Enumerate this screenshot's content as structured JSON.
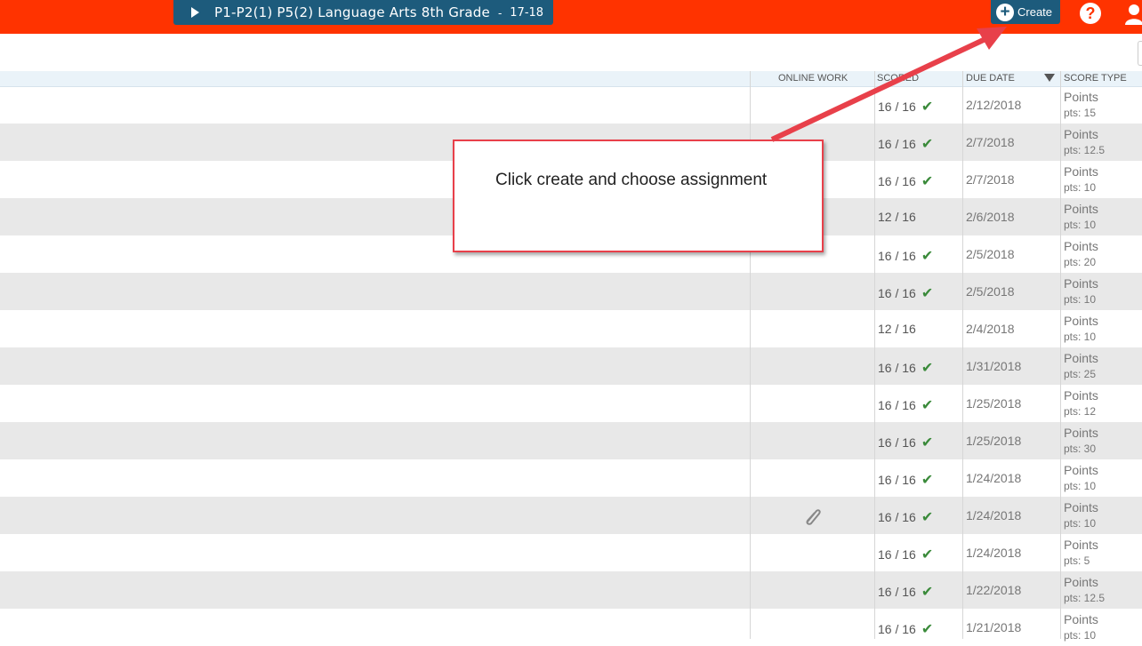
{
  "header": {
    "class_name": "P1-P2(1) P5(2) Language Arts 8th Grade",
    "separator": "-",
    "year": "17-18",
    "create_label": "Create",
    "help_symbol": "?"
  },
  "table": {
    "columns": {
      "online_work": "ONLINE WORK",
      "scored": "SCORED",
      "due_date": "DUE DATE",
      "score_type": "SCORE TYPE"
    },
    "rows": [
      {
        "scored": "16 / 16",
        "complete": true,
        "due": "2/12/2018",
        "type": "Points",
        "pts": "pts: 15",
        "attachment": false
      },
      {
        "scored": "16 / 16",
        "complete": true,
        "due": "2/7/2018",
        "type": "Points",
        "pts": "pts: 12.5",
        "attachment": false
      },
      {
        "scored": "16 / 16",
        "complete": true,
        "due": "2/7/2018",
        "type": "Points",
        "pts": "pts: 10",
        "attachment": false
      },
      {
        "scored": "12 / 16",
        "complete": false,
        "due": "2/6/2018",
        "type": "Points",
        "pts": "pts: 10",
        "attachment": false
      },
      {
        "scored": "16 / 16",
        "complete": true,
        "due": "2/5/2018",
        "type": "Points",
        "pts": "pts: 20",
        "attachment": false
      },
      {
        "scored": "16 / 16",
        "complete": true,
        "due": "2/5/2018",
        "type": "Points",
        "pts": "pts: 10",
        "attachment": false
      },
      {
        "scored": "12 / 16",
        "complete": false,
        "due": "2/4/2018",
        "type": "Points",
        "pts": "pts: 10",
        "attachment": false
      },
      {
        "scored": "16 / 16",
        "complete": true,
        "due": "1/31/2018",
        "type": "Points",
        "pts": "pts: 25",
        "attachment": false
      },
      {
        "scored": "16 / 16",
        "complete": true,
        "due": "1/25/2018",
        "type": "Points",
        "pts": "pts: 12",
        "attachment": false
      },
      {
        "scored": "16 / 16",
        "complete": true,
        "due": "1/25/2018",
        "type": "Points",
        "pts": "pts: 30",
        "attachment": false
      },
      {
        "scored": "16 / 16",
        "complete": true,
        "due": "1/24/2018",
        "type": "Points",
        "pts": "pts: 10",
        "attachment": false
      },
      {
        "scored": "16 / 16",
        "complete": true,
        "due": "1/24/2018",
        "type": "Points",
        "pts": "pts: 10",
        "attachment": true
      },
      {
        "scored": "16 / 16",
        "complete": true,
        "due": "1/24/2018",
        "type": "Points",
        "pts": "pts: 5",
        "attachment": false
      },
      {
        "scored": "16 / 16",
        "complete": true,
        "due": "1/22/2018",
        "type": "Points",
        "pts": "pts: 12.5",
        "attachment": false
      },
      {
        "scored": "16 / 16",
        "complete": true,
        "due": "1/21/2018",
        "type": "Points",
        "pts": "pts: 10",
        "attachment": false
      }
    ]
  },
  "callout": {
    "text": "Click create and choose assignment"
  },
  "colors": {
    "topbar": "#ff3300",
    "tab": "#1d5b7c",
    "check": "#3a8a3a",
    "callout_border": "#e8404a"
  },
  "icons": {
    "play": "play-icon",
    "create": "plus-circle-icon",
    "help": "help-icon",
    "user": "user-icon",
    "check": "checkmark-icon",
    "attachment": "paperclip-icon",
    "sort": "sort-down-icon"
  }
}
